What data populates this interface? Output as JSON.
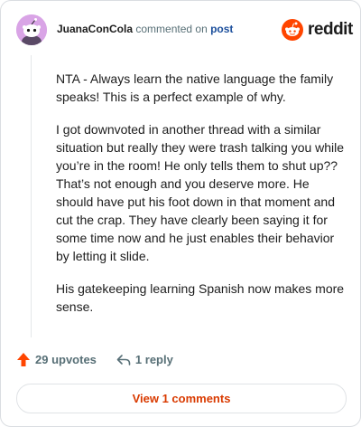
{
  "comment": {
    "username": "JuanaConCola",
    "commented_on_text": "commented on",
    "post_link_text": "post",
    "paragraphs": [
      "NTA - Always learn the native language the family speaks! This is a perfect example of why.",
      "I got downvoted in another thread with a similar situation but really they were trash talking you while you’re in the room! He only tells them to shut up?? That’s not enough and you deserve more. He should have put his foot down in that moment and cut the crap. They have clearly been saying it for some time now and he just enables their behavior by letting it slide.",
      "His gatekeeping learning Spanish now makes more sense."
    ]
  },
  "brand": {
    "logo_text": "reddit",
    "accent_color": "#ff4500"
  },
  "actions": {
    "upvotes_label": "29 upvotes",
    "replies_label": "1 reply",
    "view_comments_label": "View 1 comments"
  },
  "icons": {
    "avatar": "snoo-avatar-icon",
    "logo": "reddit-snoo-icon",
    "upvote": "upvote-arrow-icon",
    "reply": "reply-arrow-icon"
  },
  "colors": {
    "link": "#1c4f9c",
    "view_comments": "#d93a00",
    "meta": "#576f76"
  }
}
